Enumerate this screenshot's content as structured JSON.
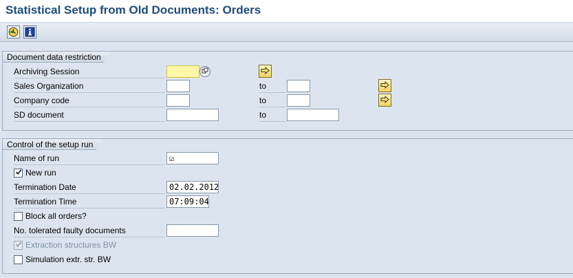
{
  "window": {
    "title": "Statistical Setup from Old Documents: Orders"
  },
  "toolbar": {
    "buttons": [
      {
        "icon": "execute-icon"
      },
      {
        "icon": "info-icon"
      }
    ]
  },
  "group1": {
    "title": "Document data restriction",
    "to_label": "to",
    "fields": {
      "archiving_session": {
        "label": "Archiving Session",
        "value": ""
      },
      "sales_org": {
        "label": "Sales Organization",
        "from": "",
        "to": ""
      },
      "company_code": {
        "label": "Company code",
        "from": "",
        "to": ""
      },
      "sd_document": {
        "label": "SD document",
        "from": "",
        "to": ""
      }
    }
  },
  "group2": {
    "title": "Control of the setup run",
    "fields": {
      "name_of_run": {
        "label": "Name of run",
        "value": "☑"
      },
      "new_run": {
        "label": "New run",
        "checked": true
      },
      "termination_date": {
        "label": "Termination Date",
        "value": "02.02.2012"
      },
      "termination_time": {
        "label": "Termination Time",
        "value": "07:09:04"
      },
      "block_all_orders": {
        "label": "Block all orders?",
        "checked": false
      },
      "tolerated_faulty": {
        "label": "No. tolerated faulty documents",
        "value": ""
      },
      "extraction_structures": {
        "label": "Extraction structures BW",
        "checked": true,
        "disabled": true
      },
      "simulation": {
        "label": "Simulation extr. str. BW",
        "checked": false
      }
    }
  },
  "colors": {
    "title": "#1d4b7a",
    "background": "#dce5ef",
    "required": "#fff7a8",
    "disabled_text": "#7f90a3"
  }
}
